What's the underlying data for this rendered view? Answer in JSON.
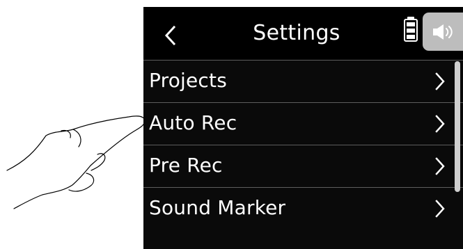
{
  "header": {
    "title": "Settings",
    "back_icon": "chevron-left-icon",
    "battery_icon": "battery-icon",
    "speaker_icon": "speaker-icon"
  },
  "menu": {
    "items": [
      {
        "label": "Projects"
      },
      {
        "label": "Auto Rec"
      },
      {
        "label": "Pre Rec"
      },
      {
        "label": "Sound Marker"
      }
    ]
  },
  "colors": {
    "screen_background": "#000000",
    "text": "#ffffff",
    "divider": "#5e5e5e",
    "speaker_tab": "#bdbdbd",
    "scrollbar": "#cfcfcf"
  }
}
